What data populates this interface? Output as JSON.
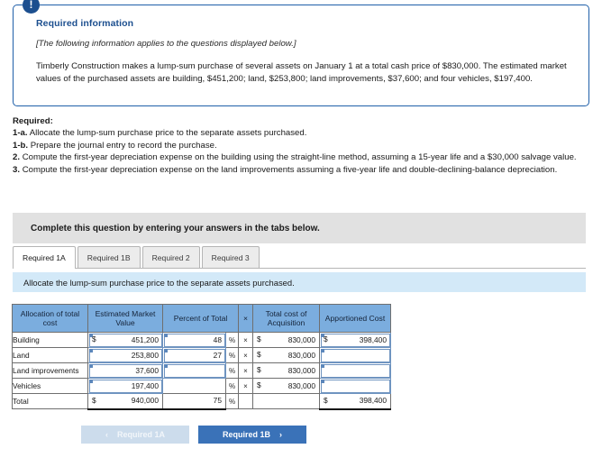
{
  "callout": {
    "badge_icon": "exclamation-icon",
    "badge_glyph": "!",
    "title": "Required information",
    "note": "[The following information applies to the questions displayed below.]",
    "body": "Timberly Construction makes a lump-sum purchase of several assets on January 1 at a total cash price of $830,000. The estimated market values of the purchased assets are building, $451,200; land, $253,800; land improvements, $37,600; and four vehicles, $197,400."
  },
  "required": {
    "heading": "Required:",
    "items": [
      {
        "label": "1-a.",
        "text": "Allocate the lump-sum purchase price to the separate assets purchased."
      },
      {
        "label": "1-b.",
        "text": "Prepare the journal entry to record the purchase."
      },
      {
        "label": "2.",
        "text": "Compute the first-year depreciation expense on the building using the straight-line method, assuming a 15-year life and a $30,000 salvage value."
      },
      {
        "label": "3.",
        "text": "Compute the first-year depreciation expense on the land improvements assuming a five-year life and double-declining-balance depreciation."
      }
    ]
  },
  "complete_bar": {
    "text": "Complete this question by entering your answers in the tabs below."
  },
  "tabs": [
    {
      "label": "Required 1A",
      "active": true
    },
    {
      "label": "Required 1B",
      "active": false
    },
    {
      "label": "Required 2",
      "active": false
    },
    {
      "label": "Required 3",
      "active": false
    }
  ],
  "instruction": {
    "text": "Allocate the lump-sum purchase price to the separate assets purchased."
  },
  "table": {
    "headers": [
      "Allocation of total cost",
      "Estimated Market Value",
      "Percent of Total",
      "×",
      "Total cost of Acquisition",
      "Apportioned Cost"
    ],
    "rows": [
      {
        "label": "Building",
        "emv_dollar": "$",
        "emv": "451,200",
        "pct": "48",
        "pct_sym": "%",
        "mult": "×",
        "tca_dollar": "$",
        "tca": "830,000",
        "app_dollar": "$",
        "app": "398,400"
      },
      {
        "label": "Land",
        "emv_dollar": "",
        "emv": "253,800",
        "pct": "27",
        "pct_sym": "%",
        "mult": "×",
        "tca_dollar": "$",
        "tca": "830,000",
        "app_dollar": "",
        "app": ""
      },
      {
        "label": "Land improvements",
        "emv_dollar": "",
        "emv": "37,600",
        "pct": "",
        "pct_sym": "%",
        "mult": "×",
        "tca_dollar": "$",
        "tca": "830,000",
        "app_dollar": "",
        "app": ""
      },
      {
        "label": "Vehicles",
        "emv_dollar": "",
        "emv": "197,400",
        "pct": "",
        "pct_sym": "%",
        "mult": "×",
        "tca_dollar": "$",
        "tca": "830,000",
        "app_dollar": "",
        "app": ""
      }
    ],
    "total": {
      "label": "Total",
      "emv_dollar": "$",
      "emv": "940,000",
      "pct": "75",
      "pct_sym": "%",
      "mult": "",
      "tca_dollar": "",
      "tca": "",
      "app_dollar": "$",
      "app": "398,400"
    }
  },
  "nav": {
    "prev_label": "Required 1A",
    "prev_chevron": "‹",
    "next_label": "Required 1B",
    "next_chevron": "›"
  },
  "colors": {
    "callout_border": "#1f5fa9",
    "callout_title": "#1c4f8f",
    "badge": "#1c4f8f",
    "complete_bar": "#e1e1e1",
    "instruction_bar": "#d3e9f8",
    "table_header": "#7badde",
    "entry_outline": "#6f94c0",
    "btn_next": "#3a72b8",
    "btn_prev": "#ccdcec"
  }
}
